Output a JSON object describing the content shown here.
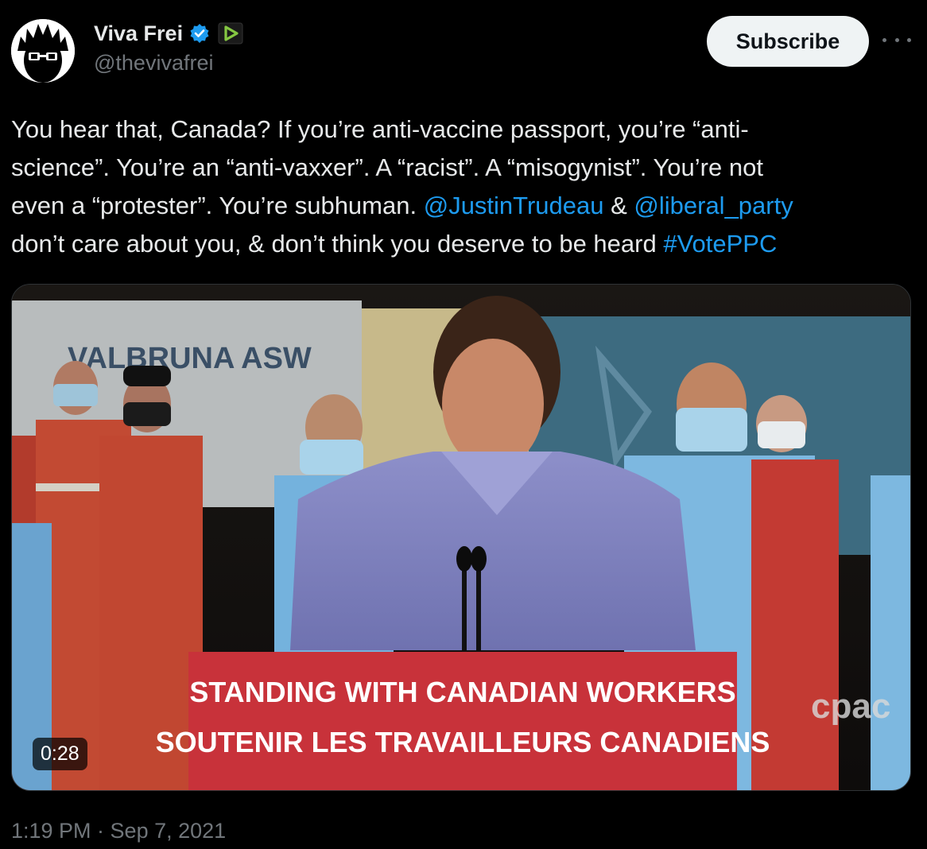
{
  "author": {
    "display_name": "Viva Frei",
    "handle": "@thevivafrei",
    "avatar_icon": "avatar-cartoon-icon",
    "verified_icon": "verified-badge-icon",
    "affiliate_icon": "rumble-play-icon"
  },
  "header": {
    "subscribe_label": "Subscribe",
    "more_icon": "more-icon"
  },
  "tweet": {
    "line1": "You hear that, Canada? If you’re anti-vaccine passport, you’re “anti-",
    "line2": "science”. You’re an “anti-vaxxer”. A “racist”. A “misogynist”. You’re not",
    "line3_pre": "even a “protester”. You’re subhuman. ",
    "mention1": "@JustinTrudeau",
    "line3_mid": " & ",
    "mention2": "@liberal_party",
    "line4_pre": "don’t care about you, & don’t think you deserve to be heard ",
    "hashtag": "#VotePPC"
  },
  "media": {
    "duration": "0:28",
    "podium_line1": "STANDING WITH CANADIAN WORKERS",
    "podium_line2": "SOUTENIR LES TRAVAILLEURS CANADIENS",
    "banner_text": "VALBRUNA ASW",
    "watermark": "cpac"
  },
  "meta": {
    "timestamp": "1:19 PM · Sep 7, 2021"
  },
  "colors": {
    "background": "#000000",
    "text": "#e7e9ea",
    "secondary": "#71767b",
    "link": "#1d9bf0",
    "verified": "#1d9bf0",
    "rumble": "#85c742",
    "podium_red": "#c8323a"
  }
}
